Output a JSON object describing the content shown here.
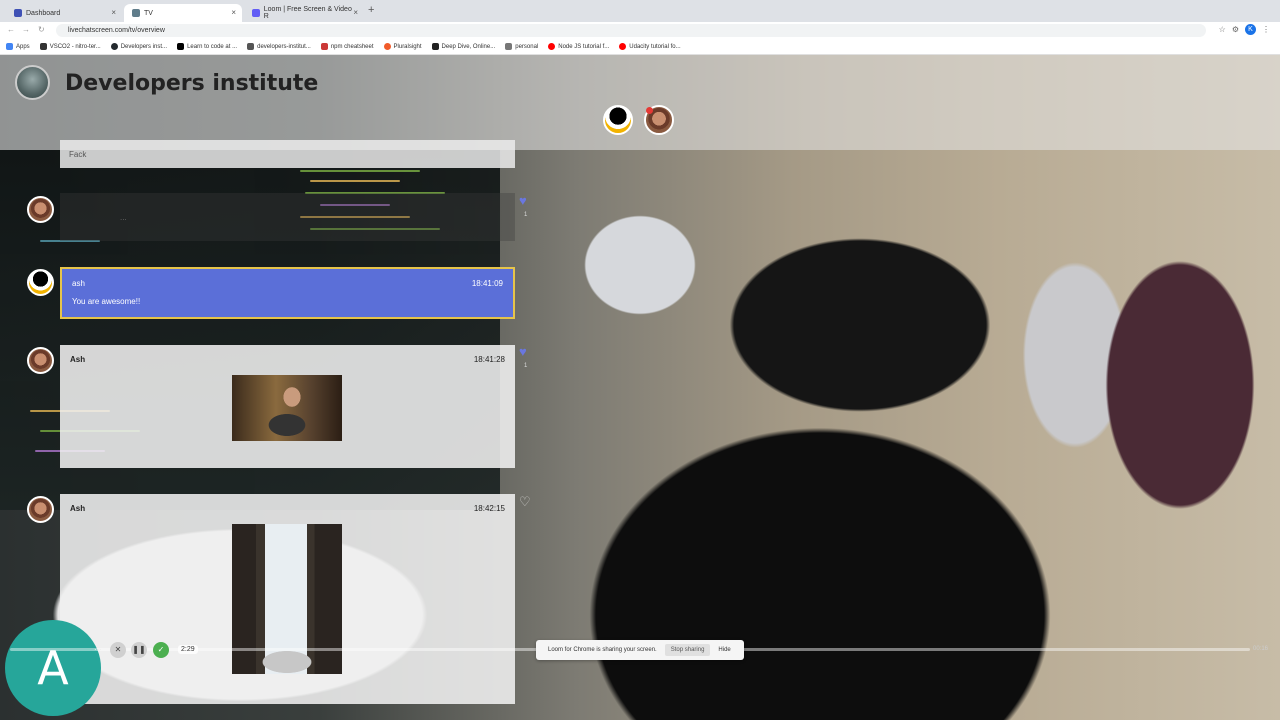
{
  "browser": {
    "tabs": [
      {
        "label": "Dashboard",
        "color": "#3f51b5"
      },
      {
        "label": "TV",
        "color": "#607d8b"
      },
      {
        "label": "Loom | Free Screen & Video R",
        "color": "#625df5"
      }
    ],
    "new_tab": "+",
    "close": "×",
    "url": "livechatscreen.com/tv/overview",
    "profile_initial": "K",
    "bookmarks": [
      {
        "label": "Apps",
        "color": "#4285f4"
      },
      {
        "label": "VSCO2 - nitro-ter...",
        "color": "#333333"
      },
      {
        "label": "Developers inst...",
        "color": "#24292e"
      },
      {
        "label": "Learn to code at ...",
        "color": "#000000"
      },
      {
        "label": "developers-institut...",
        "color": "#555555"
      },
      {
        "label": "npm cheatsheet",
        "color": "#cb3837"
      },
      {
        "label": "Pluralsight",
        "color": "#f15b2a"
      },
      {
        "label": "Deep Dive, Online...",
        "color": "#222222"
      },
      {
        "label": "personal",
        "color": "#777777"
      },
      {
        "label": "Node JS tutorial f...",
        "color": "#ff0000"
      },
      {
        "label": "Udacity tutorial fo...",
        "color": "#ff0000"
      }
    ]
  },
  "page": {
    "title": "Developers institute",
    "top_input_text": "Fack",
    "messages": [
      {
        "author": "",
        "time": "",
        "body": "...",
        "liked": true,
        "likes": "1"
      },
      {
        "author": "ash",
        "time": "18:41:09",
        "body": "You are awesome!!"
      },
      {
        "author": "Ash",
        "time": "18:41:28",
        "body": "",
        "liked": true,
        "likes": "1"
      },
      {
        "author": "Ash",
        "time": "18:42:15",
        "body": "",
        "liked": false
      }
    ],
    "viewer_initial": "A"
  },
  "recorder": {
    "elapsed": "2:29",
    "end": "00:16",
    "share_text": "Loom for Chrome is sharing your screen.",
    "stop_label": "Stop sharing",
    "hide_label": "Hide"
  }
}
